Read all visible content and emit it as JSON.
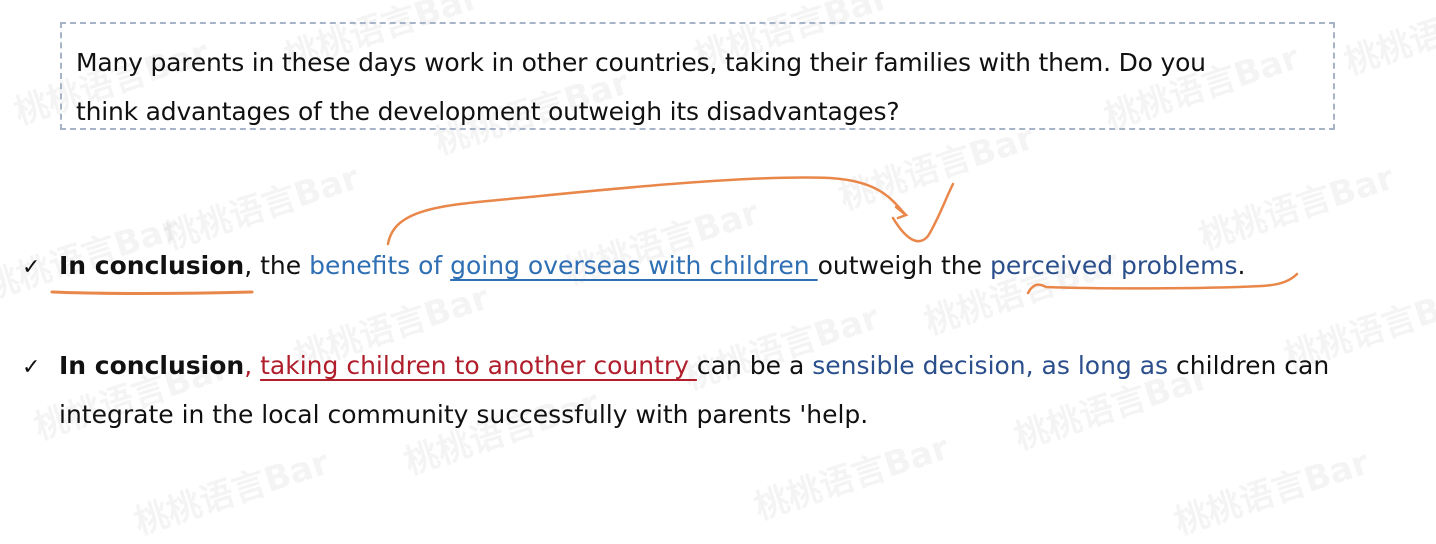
{
  "question": {
    "line1": "Many parents in these days work in other countries, taking their families with them. Do you",
    "line2": "think advantages of the development outweigh its disadvantages?"
  },
  "sentences": [
    {
      "check": "✓",
      "bold": "In conclusion",
      "after_bold": ", the ",
      "blue": "benefits of ",
      "blue_underlined": "going overseas with children ",
      "middle": "outweigh the ",
      "navy": "perceived problems",
      "end": "."
    },
    {
      "check": "✓",
      "bold": "In conclusion",
      "comma": ", ",
      "red_underlined": "taking children to another country ",
      "middle": "can be a ",
      "navy": "sensible decision, as long as",
      "end": " children can",
      "line2": "integrate in the local community successfully with parents 'help."
    }
  ],
  "watermark": "桃桃语言Bar",
  "colors": {
    "blue": "#2f6fb3",
    "navy": "#2b4f8c",
    "red": "#b01e2c",
    "annotation": "#e9874a",
    "box_border": "#a7b4c8"
  }
}
